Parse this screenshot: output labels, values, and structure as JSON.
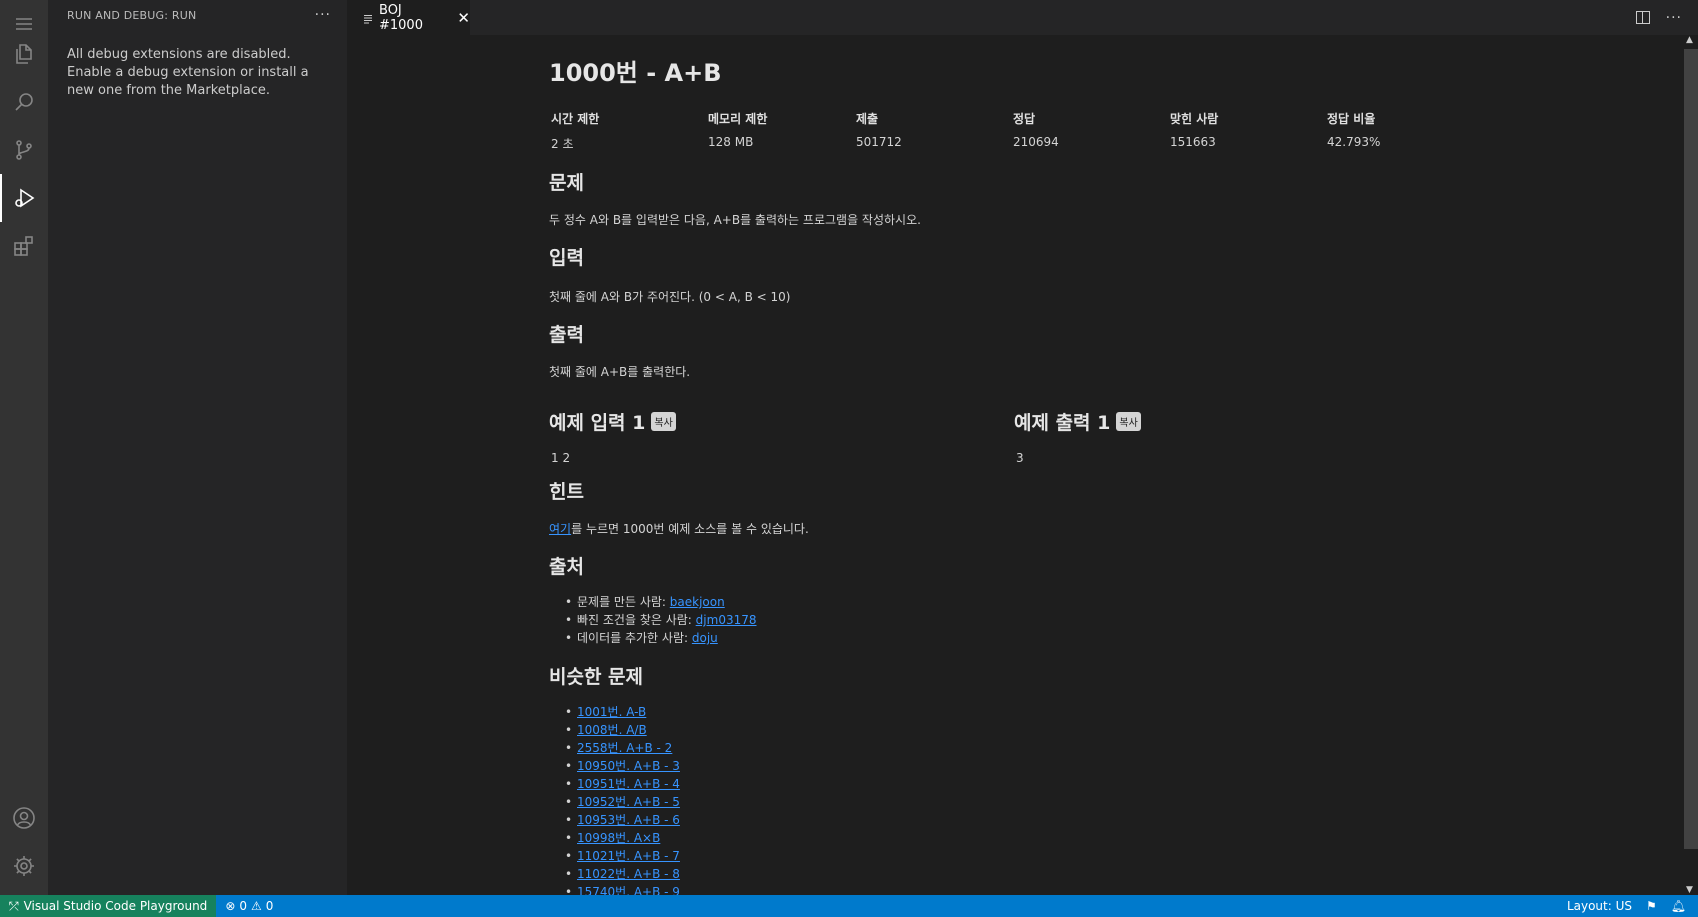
{
  "sidebar": {
    "title": "RUN AND DEBUG: RUN",
    "more": "···",
    "message": "All debug extensions are disabled. Enable a debug extension or install a new one from the Marketplace."
  },
  "tab": {
    "label": "BOJ #1000",
    "close": "✕"
  },
  "problem": {
    "title": "1000번 - A+B",
    "info_headers": [
      "시간 제한",
      "메모리 제한",
      "제출",
      "정답",
      "맞힌 사람",
      "정답 비율"
    ],
    "info_values": [
      "2 초",
      "128 MB",
      "501712",
      "210694",
      "151663",
      "42.793%"
    ],
    "desc_heading": "문제",
    "desc": "두 정수 A와 B를 입력받은 다음, A+B를 출력하는 프로그램을 작성하시오.",
    "input_heading": "입력",
    "input": "첫째 줄에 A와 B가 주어진다. (0 < A, B < 10)",
    "output_heading": "출력",
    "output": "첫째 줄에 A+B를 출력한다.",
    "sample_input_heading": "예제 입력 1",
    "sample_input": "1 2",
    "sample_output_heading": "예제 출력 1",
    "sample_output": "3",
    "copy_label": "복사",
    "hint_heading": "힌트",
    "hint_link": "여기",
    "hint_text": "를 누르면 1000번 예제 소스를 볼 수 있습니다.",
    "source_heading": "출처",
    "sources": [
      {
        "label": "문제를 만든 사람: ",
        "user": "baekjoon"
      },
      {
        "label": "빠진 조건을 찾은 사람: ",
        "user": "djm03178"
      },
      {
        "label": "데이터를 추가한 사람: ",
        "user": "doju"
      }
    ],
    "similar_heading": "비슷한 문제",
    "similar": [
      "1001번. A-B",
      "1008번. A/B",
      "2558번. A+B - 2",
      "10950번. A+B - 3",
      "10951번. A+B - 4",
      "10952번. A+B - 5",
      "10953번. A+B - 6",
      "10998번. A×B",
      "11021번. A+B - 7",
      "11022번. A+B - 8",
      "15740번. A+B - 9"
    ]
  },
  "statusbar": {
    "remote_label": "Visual Studio Code Playground",
    "errors": "0",
    "warnings": "0",
    "layout": "Layout: US"
  }
}
